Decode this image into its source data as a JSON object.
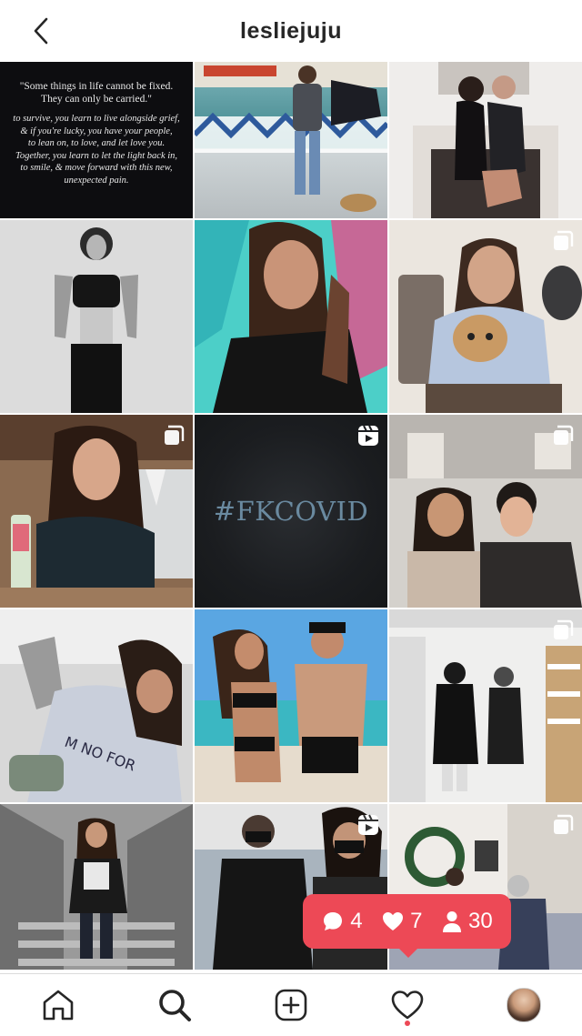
{
  "header": {
    "title": "lesliejuju"
  },
  "quote_post": {
    "line1": "\"Some things in life cannot be fixed.\nThey can only be carried.\"",
    "line2": "to survive, you learn to live alongside grief,\n& if you're lucky, you have your people,\nto lean on, to love, and let love you.\nTogether, you learn to let the light back in,\nto smile, & move forward with this new,\nunexpected pain."
  },
  "covid_post": {
    "text": "#FKCOVID"
  },
  "activity": {
    "comments": "4",
    "likes": "7",
    "follows": "30"
  },
  "colors": {
    "accent": "#ed4956",
    "text": "#262626"
  },
  "tabs": [
    "home-icon",
    "search-icon",
    "new-post-icon",
    "activity-heart-icon",
    "profile-avatar"
  ]
}
